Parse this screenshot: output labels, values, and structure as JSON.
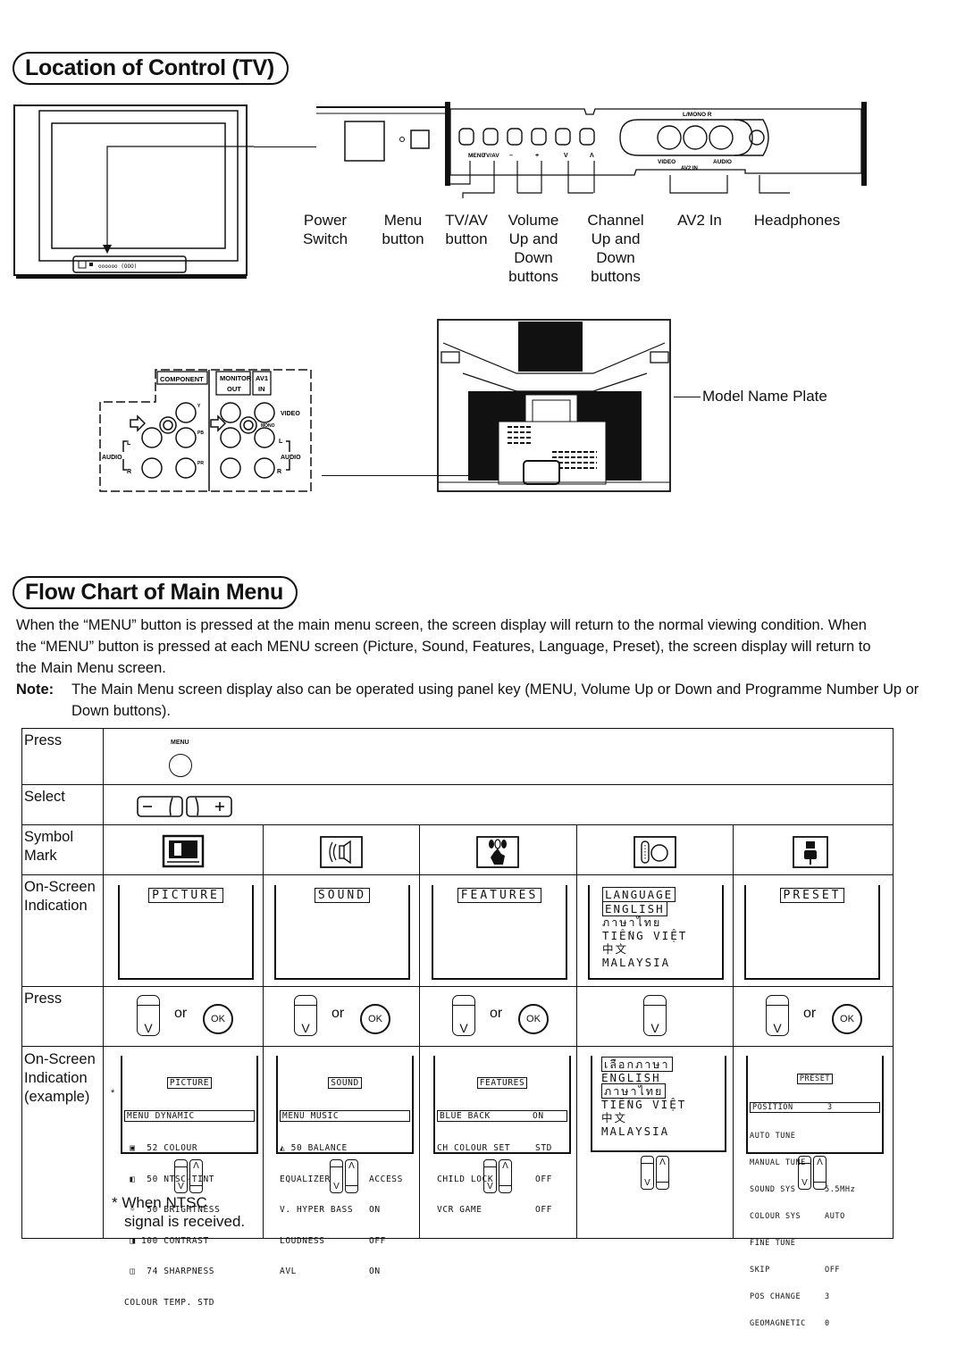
{
  "location_section": {
    "title": "Location of Control (TV)",
    "panel_markings": {
      "menu": "MENU",
      "tvav": "TV/AV",
      "vol_minus": "–",
      "vol_plus": "+",
      "ch_down": "V",
      "ch_up": "Λ",
      "lmono_r": "L/MONO R",
      "video": "VIDEO",
      "audio": "AUDIO",
      "av2in": "AV2 IN"
    },
    "callouts": [
      {
        "line1": "Power",
        "line2": "Switch",
        "line3": "",
        "line4": ""
      },
      {
        "line1": "Menu",
        "line2": "button",
        "line3": "",
        "line4": ""
      },
      {
        "line1": "TV/AV",
        "line2": "button",
        "line3": "",
        "line4": ""
      },
      {
        "line1": "Volume",
        "line2": "Up and",
        "line3": "Down",
        "line4": "buttons"
      },
      {
        "line1": "Channel",
        "line2": "Up and",
        "line3": "Down",
        "line4": "buttons"
      },
      {
        "line1": "AV2 In",
        "line2": "",
        "line3": "",
        "line4": ""
      },
      {
        "line1": "Headphones",
        "line2": "",
        "line3": "",
        "line4": ""
      }
    ],
    "rear_panel": {
      "component": "COMPONENT",
      "monitor_out_1": "MONITOR",
      "monitor_out_2": "OUT",
      "av1_in_1": "AV1",
      "av1_in_2": "IN",
      "video": "VIDEO",
      "mono": "MONO",
      "audio_left": "AUDIO",
      "audio_right": "AUDIO",
      "l": "L",
      "r": "R",
      "y": "Y",
      "pb": "PB",
      "pr": "PR"
    },
    "model_name_plate": "Model Name Plate"
  },
  "flow_section": {
    "title": "Flow Chart of Main Menu",
    "paragraph": "When the “MENU” button is pressed at the main menu screen, the screen display will return to the normal viewing condition. When the “MENU” button is pressed at each MENU screen (Picture, Sound, Features, Language, Preset), the screen display will return to the Main Menu screen.",
    "note_label": "Note:",
    "note_text": "The Main Menu screen display also can be operated using panel key (MENU, Volume Up or Down and Programme Number Up or Down buttons)."
  },
  "table": {
    "row_labels": {
      "press1": "Press",
      "select": "Select",
      "symbol_1": "Symbol",
      "symbol_2": "Mark",
      "osi_1": "On-Screen",
      "osi_2": "Indication",
      "press2": "Press",
      "osie_1": "On-Screen",
      "osie_2": "Indication",
      "osie_3": "(example)"
    },
    "menu_button_label": "MENU",
    "select_minus": "–",
    "select_plus": "+",
    "or_text": "or",
    "ok_text": "OK",
    "down_glyph": "V",
    "up_glyph": "Λ",
    "columns": [
      {
        "symbol": "picture-icon",
        "title": "PICTURE"
      },
      {
        "symbol": "sound-icon",
        "title": "SOUND"
      },
      {
        "symbol": "features-icon",
        "title": "FEATURES"
      },
      {
        "symbol": "language-icon",
        "title": "LANGUAGE",
        "languages": [
          "ENGLISH",
          "ภาษาไทย",
          "TIẾNG VIỆT",
          "中文",
          "MALAYSIA"
        ]
      },
      {
        "symbol": "preset-icon",
        "title": "PRESET"
      }
    ],
    "examples": {
      "picture": {
        "title": "PICTURE",
        "highlight": "MENU DYNAMIC",
        "rows": [
          {
            "mark": "",
            "value": "52",
            "label": "COLOUR"
          },
          {
            "mark": "*",
            "value": "50",
            "label": "NTSC-TINT"
          },
          {
            "mark": "",
            "value": "50",
            "label": "BRIGHTNESS"
          },
          {
            "mark": "",
            "value": "100",
            "label": "CONTRAST"
          },
          {
            "mark": "",
            "value": "74",
            "label": "SHARPNESS"
          }
        ],
        "last": "COLOUR TEMP. STD"
      },
      "sound": {
        "title": "SOUND",
        "highlight": "MENU MUSIC",
        "rows": [
          {
            "label": "50 BALANCE",
            "value": ""
          },
          {
            "label": "EQUALIZER",
            "value": "ACCESS"
          },
          {
            "label": "V. HYPER BASS",
            "value": "ON"
          },
          {
            "label": "LOUDNESS",
            "value": "OFF"
          },
          {
            "label": "AVL",
            "value": "ON"
          }
        ]
      },
      "features": {
        "title": "FEATURES",
        "highlight_label": "BLUE BACK",
        "highlight_value": "ON",
        "rows": [
          {
            "label": "CH COLOUR SET",
            "value": "STD"
          },
          {
            "label": "CHILD LOCK",
            "value": "OFF"
          },
          {
            "label": "VCR GAME",
            "value": "OFF"
          }
        ]
      },
      "language": {
        "title": "เลือกภาษา",
        "items": [
          "ENGLISH",
          "ภาษาไทย",
          "TIẾNG VIỆT",
          "中文",
          "MALAYSIA"
        ],
        "selected_index": 1
      },
      "preset": {
        "title": "PRESET",
        "highlight_label": "POSITION",
        "highlight_value": "3",
        "rows": [
          {
            "label": "AUTO TUNE",
            "value": ""
          },
          {
            "label": "MANUAL TUNE",
            "value": ""
          },
          {
            "label": "SOUND SYS",
            "value": "5.5MHz"
          },
          {
            "label": "COLOUR SYS",
            "value": "AUTO"
          },
          {
            "label": "FINE TUNE",
            "value": ""
          },
          {
            "label": "SKIP",
            "value": "OFF"
          },
          {
            "label": "POS CHANGE",
            "value": "3"
          },
          {
            "label": "GEOMAGNETIC",
            "value": "0"
          }
        ]
      }
    },
    "footnote_line1": "* When NTSC",
    "footnote_line2": "signal is received."
  }
}
